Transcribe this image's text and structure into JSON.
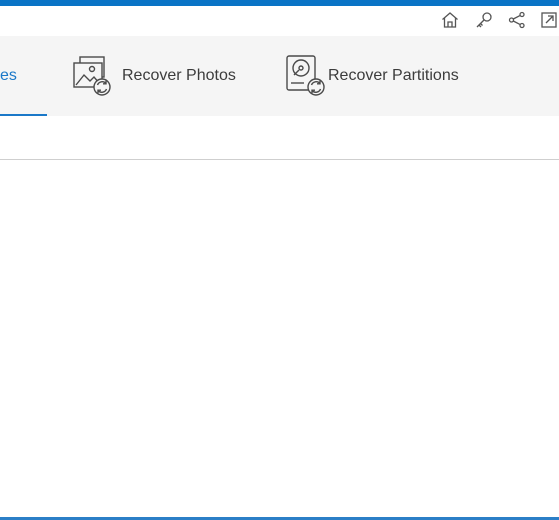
{
  "window": {
    "accent_color": "#0a74c6",
    "title_bar_icons": [
      {
        "name": "home-icon"
      },
      {
        "name": "key-icon"
      },
      {
        "name": "share-icon"
      },
      {
        "name": "expand-icon"
      }
    ]
  },
  "tabs": [
    {
      "label": "es",
      "active": true,
      "icon": "recover-files-icon"
    },
    {
      "label": "Recover Photos",
      "active": false,
      "icon": "recover-photos-icon"
    },
    {
      "label": "Recover Partitions",
      "active": false,
      "icon": "recover-partitions-icon"
    }
  ],
  "colors": {
    "active_tab": "#1a78c8",
    "tab_strip_bg": "#f5f5f5",
    "divider": "#cfcfcf"
  }
}
